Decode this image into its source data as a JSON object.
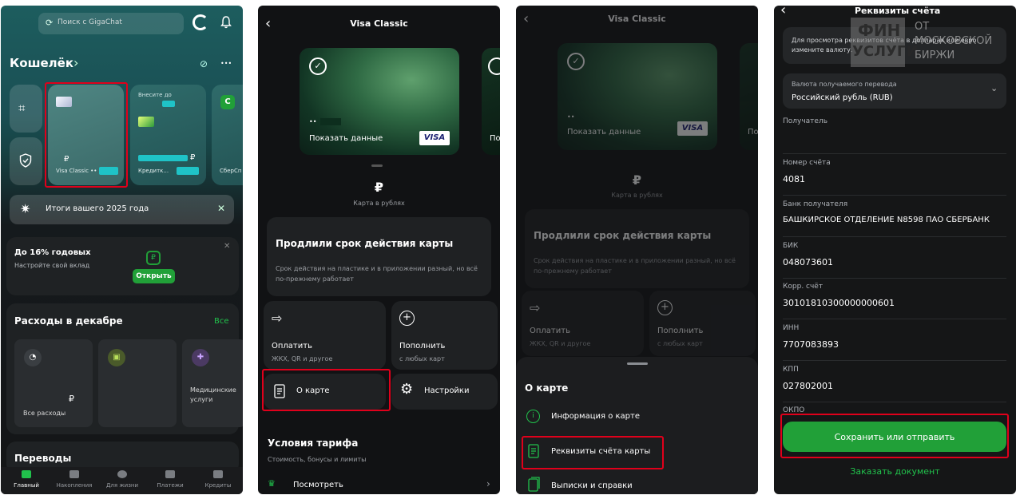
{
  "panel1": {
    "search": {
      "placeholder": "Поиск с GigaChat"
    },
    "wallet": {
      "title": "Кошелёк",
      "chevron": "›",
      "more": "•••"
    },
    "cards": [
      {
        "label": "Visa Classic ••",
        "currency": "₽"
      },
      {
        "top": "Внесите до",
        "label": "Кредитк...",
        "currency": "₽"
      },
      {
        "label": "СберСп"
      }
    ],
    "results_banner": "Итоги вашего 2025 года",
    "deposit": {
      "title": "До 16% годовых",
      "subtitle": "Настройте свой вклад",
      "button": "Открыть"
    },
    "spending": {
      "title": "Расходы в декабре",
      "all_link": "Все",
      "all_label": "Все расходы",
      "currency": "₽",
      "medical": "Медицинские услуги"
    },
    "transfers": {
      "title": "Переводы"
    },
    "bottom_nav": [
      {
        "label": "Главный"
      },
      {
        "label": "Накопления"
      },
      {
        "label": "Для жизни"
      },
      {
        "label": "Платежи"
      },
      {
        "label": "Кредиты"
      }
    ]
  },
  "panel2": {
    "title": "Visa Classic",
    "card": {
      "mask": "••",
      "show": "Показать данные",
      "brand": "VISA",
      "next_show": "По"
    },
    "currency_symbol": "₽",
    "currency_label": "Карта в рублях",
    "notice": {
      "title": "Продлили срок действия карты",
      "body": "Срок действия на пластике и в приложении разный, но всё по-прежнему работает"
    },
    "actions": {
      "pay_title": "Оплатить",
      "pay_sub": "ЖКХ, QR и другое",
      "topup_title": "Пополнить",
      "topup_sub": "с любых карт",
      "about": "О карте",
      "settings": "Настройки"
    },
    "tariff": {
      "title": "Условия тарифа",
      "subtitle": "Стоимость, бонусы и лимиты",
      "view": "Посмотреть"
    }
  },
  "panel3": {
    "title": "Visa Classic",
    "card": {
      "mask": "••",
      "show": "Показать данные",
      "brand": "VISA",
      "next_show": "По"
    },
    "currency_symbol": "₽",
    "currency_label": "Карта в рублях",
    "notice": {
      "title": "Продлили срок действия карты",
      "body": "Срок действия на пластике и в приложении разный, но всё по-прежнему работает"
    },
    "actions": {
      "pay_title": "Оплатить",
      "pay_sub": "ЖКХ, QR и другое",
      "topup_title": "Пополнить",
      "topup_sub": "с любых карт"
    },
    "sheet": {
      "title": "О карте",
      "items": [
        {
          "label": "Информация о карте"
        },
        {
          "label": "Реквизиты счёта карты"
        },
        {
          "label": "Выписки и справки"
        }
      ]
    }
  },
  "panel4": {
    "title": "Реквизиты счёта",
    "info": "Для просмотра реквизитов счёта в долларах или евро измените валюту.",
    "currency_select": {
      "label": "Валюта получаемого перевода",
      "value": "Российский рубль (RUB)"
    },
    "fields": [
      {
        "label": "Получатель",
        "value": ""
      },
      {
        "label": "Номер счёта",
        "value": "4081"
      },
      {
        "label": "Банк получателя",
        "value": "БАШКИРСКОЕ ОТДЕЛЕНИЕ N8598 ПАО СБЕРБАНК"
      },
      {
        "label": "БИК",
        "value": "048073601"
      },
      {
        "label": "Корр. счёт",
        "value": "30101810300000000601"
      },
      {
        "label": "ИНН",
        "value": "7707083893"
      },
      {
        "label": "КПП",
        "value": "027802001"
      },
      {
        "label": "ОКПО",
        "value": ""
      }
    ],
    "save_button": "Сохранить или отправить",
    "order_link": "Заказать документ"
  },
  "watermark": {
    "line1": "ФИН",
    "line2": "УСЛУГИ",
    "line3": "ОТ",
    "line4": "МОСКОВСКОЙ",
    "line5": "БИРЖИ"
  },
  "colors": {
    "accent_green": "#21a038",
    "highlight_red": "#e0001b",
    "link_green": "#21c24c"
  }
}
